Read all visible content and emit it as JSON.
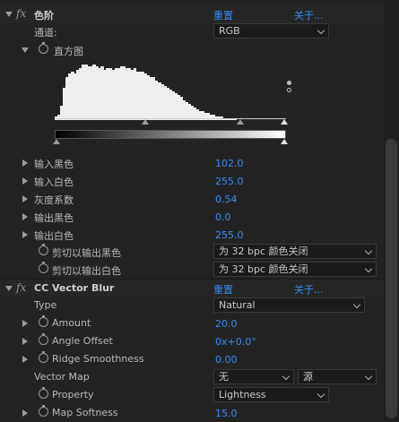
{
  "effects": [
    {
      "name": "色阶",
      "reset": "重置",
      "about": "关于...",
      "channel_label": "通道:",
      "channel_value": "RGB",
      "histogram_label": "直方图",
      "params": [
        {
          "label": "输入黑色",
          "value": "102.0"
        },
        {
          "label": "输入白色",
          "value": "255.0"
        },
        {
          "label": "灰度系数",
          "value": "0.54"
        },
        {
          "label": "输出黑色",
          "value": "0.0"
        },
        {
          "label": "输出白色",
          "value": "255.0"
        }
      ],
      "clip_params": [
        {
          "label": "剪切以输出黑色",
          "value": "为 32 bpc 颜色关闭"
        },
        {
          "label": "剪切以输出白色",
          "value": "为 32 bpc 颜色关闭"
        }
      ]
    },
    {
      "name": "CC Vector Blur",
      "reset": "重置",
      "about": "关于...",
      "type_label": "Type",
      "type_value": "Natural",
      "amount_label": "Amount",
      "amount_value": "20.0",
      "angle_label": "Angle Offset",
      "angle_turns": "0x",
      "angle_deg": "+0.0°",
      "ridge_label": "Ridge Smoothness",
      "ridge_value": "0.00",
      "vector_map_label": "Vector Map",
      "vector_map_value": "无",
      "vector_map_source": "源",
      "property_label": "Property",
      "property_value": "Lightness",
      "softness_label": "Map Softness",
      "softness_value": "15.0"
    }
  ],
  "histogram": [
    2,
    3,
    8,
    18,
    24,
    26,
    27,
    26,
    28,
    29,
    31,
    31,
    30,
    30,
    31,
    30,
    29,
    30,
    28,
    29,
    29,
    28,
    29,
    29,
    30,
    30,
    29,
    29,
    28,
    29,
    27,
    27,
    27,
    26,
    25,
    24,
    24,
    22,
    21,
    20,
    19,
    18,
    17,
    16,
    15,
    14,
    13,
    11,
    10,
    9,
    8,
    7,
    6,
    5,
    5,
    4,
    4,
    3,
    3,
    2,
    2,
    2,
    1,
    1,
    1,
    1,
    1,
    0,
    0,
    0,
    0,
    0,
    0,
    0,
    0,
    0,
    0,
    0,
    0,
    0,
    0,
    0,
    0,
    0,
    0
  ],
  "colors": {
    "accent": "#3b8be6",
    "background": "#232323",
    "text": "#b9b9b9"
  }
}
